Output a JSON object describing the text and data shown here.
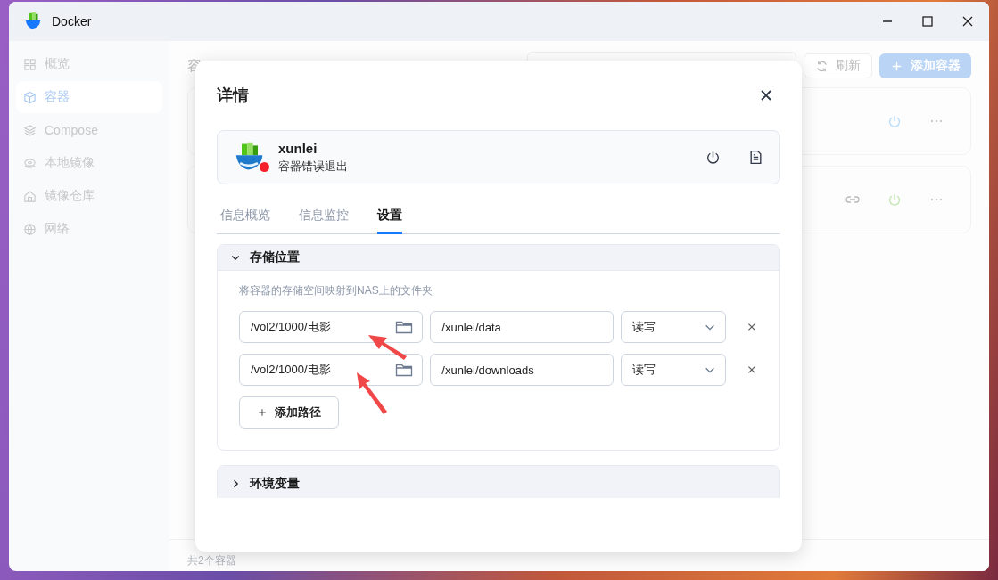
{
  "window": {
    "title": "Docker"
  },
  "sidebar": {
    "items": [
      {
        "label": "概览",
        "selected": false
      },
      {
        "label": "容器",
        "selected": true
      },
      {
        "label": "Compose",
        "selected": false
      },
      {
        "label": "本地镜像",
        "selected": false
      },
      {
        "label": "镜像仓库",
        "selected": false
      },
      {
        "label": "网络",
        "selected": false
      }
    ]
  },
  "main": {
    "heading": "容",
    "refresh_button": "刷新",
    "add_button": "添加容器",
    "containers": [
      {
        "link": false,
        "color": "#b9dcf9"
      },
      {
        "link": true,
        "color": "#c4e6b4"
      }
    ],
    "footer": "共2个容器"
  },
  "dialog": {
    "title": "详情",
    "container": {
      "name": "xunlei",
      "status": "容器错误退出",
      "color": "#f5222d"
    },
    "tabs": [
      {
        "label": "信息概览",
        "selected": false
      },
      {
        "label": "信息监控",
        "selected": false
      },
      {
        "label": "设置",
        "selected": true
      }
    ],
    "sections": [
      {
        "title": "存储位置",
        "expanded": true,
        "description": "将容器的存储空间映射到NAS上的文件夹",
        "mappings": [
          {
            "host_path": "/vol2/1000/电影",
            "container_path": "/xunlei/data",
            "mode": "读写"
          },
          {
            "host_path": "/vol2/1000/电影",
            "container_path": "/xunlei/downloads",
            "mode": "读写"
          }
        ],
        "add_button": "添加路径"
      },
      {
        "title": "环境变量",
        "expanded": false
      }
    ]
  }
}
